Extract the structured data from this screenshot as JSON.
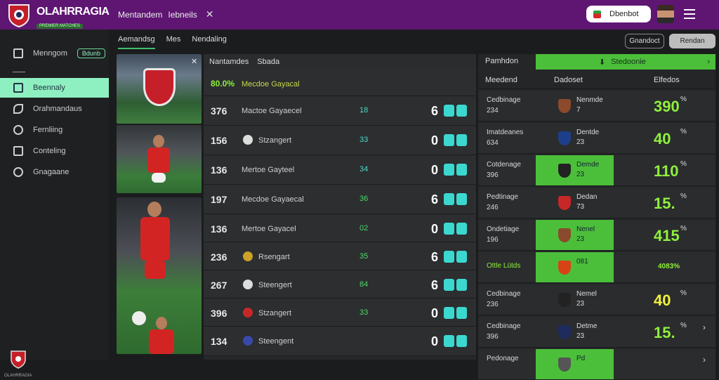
{
  "header": {
    "brand_title": "OLAHRRAGIA",
    "brand_sub": "PREMIER MATCHES",
    "nav1": "Mentandem",
    "nav2": "Iebneils",
    "nav_close": "✕",
    "button_label": "Dbenbot",
    "menu_icon": "hamburger-icon"
  },
  "sidebar": {
    "items": [
      {
        "label": "Menngom",
        "badge": "Bdunb",
        "icon": "home-icon"
      },
      {
        "label": "Beennaly",
        "icon": "clipboard-icon"
      },
      {
        "label": "Orahmandaus",
        "icon": "leaf-icon"
      },
      {
        "label": "Fernliing",
        "icon": "search-icon"
      },
      {
        "label": "Conteling",
        "icon": "calendar-icon"
      },
      {
        "label": "Gnagaane",
        "icon": "gear-icon"
      }
    ],
    "footer": "OLAHRRAGIA"
  },
  "tabs": [
    {
      "label": "Aemandsg",
      "active": true
    },
    {
      "label": "Mes",
      "active": false
    },
    {
      "label": "Nendaling",
      "active": false
    }
  ],
  "top_buttons": {
    "left": "Gnandoct",
    "right": "Rendan"
  },
  "matches": {
    "header_col1": "Nantamdes",
    "header_col2": "Sbada",
    "rows": [
      {
        "num": "80.0%",
        "name": "Mecdoe Gayacal",
        "mid": "",
        "score": "",
        "highlight": true
      },
      {
        "num": "376",
        "name": "Mactoe Gayaecel",
        "mid": "18",
        "score": "6"
      },
      {
        "num": "156",
        "name": "Stzangert",
        "mid": "33",
        "score": "0"
      },
      {
        "num": "136",
        "name": "Mertoe Gayteel",
        "mid": "34",
        "score": "0"
      },
      {
        "num": "197",
        "name": "Mecdoe Gayaecal",
        "mid": "36",
        "score": "6"
      },
      {
        "num": "136",
        "name": "Mertoe Gayacel",
        "mid": "02",
        "score": "0"
      },
      {
        "num": "236",
        "name": "Rsengart",
        "mid": "35",
        "score": "6"
      },
      {
        "num": "267",
        "name": "Steengert",
        "mid": "84",
        "score": "6"
      },
      {
        "num": "396",
        "name": "Stzangert",
        "mid": "33",
        "score": "0"
      },
      {
        "num": "134",
        "name": "Steengent",
        "mid": "",
        "score": "0"
      }
    ]
  },
  "standings": {
    "title": "Pamhdon",
    "green_label": "Stedoonie",
    "sub1": "Meedend",
    "sub2": "Dadoset",
    "sub3": "Elfedos",
    "rows": [
      {
        "l1": "Cedbinage",
        "l2": "234",
        "c1": "Nenmde",
        "c2": "7",
        "big": "390",
        "pct": "%",
        "green": false
      },
      {
        "l1": "Imatdeanes",
        "l2": "634",
        "c1": "Dentde",
        "c2": "23",
        "big": "40",
        "pct": "%",
        "green": false
      },
      {
        "l1": "Cotdenage",
        "l2": "396",
        "c1": "Demde",
        "c2": "23",
        "big": "110",
        "pct": "%",
        "green": true
      },
      {
        "l1": "Pedtinage",
        "l2": "246",
        "c1": "Dedan",
        "c2": "73",
        "big": "15.",
        "pct": "%",
        "green": false
      },
      {
        "l1": "Ondetiage",
        "l2": "196",
        "c1": "Nenel",
        "c2": "23",
        "big": "415",
        "pct": "%",
        "green": true
      },
      {
        "l1": "Ottle Lütds",
        "l2": "",
        "c1": "081",
        "c2": "",
        "big": "4083%",
        "pct": "",
        "green": true
      },
      {
        "l1": "Cedbinage",
        "l2": "236",
        "c1": "Nemel",
        "c2": "23",
        "big": "40",
        "pct": "%",
        "green": false
      },
      {
        "l1": "Cedbinage",
        "l2": "396",
        "c1": "Detme",
        "c2": "23",
        "big": "15.",
        "pct": "%",
        "green": false
      },
      {
        "l1": "Pedonage",
        "l2": "",
        "c1": "Pd",
        "c2": "",
        "big": "",
        "pct": "",
        "green": true
      }
    ]
  },
  "colors": {
    "header_bg": "#5e1672",
    "accent_green": "#4cbf3a",
    "accent_mint": "#8ef0c0",
    "teal": "#3bd8d0"
  }
}
